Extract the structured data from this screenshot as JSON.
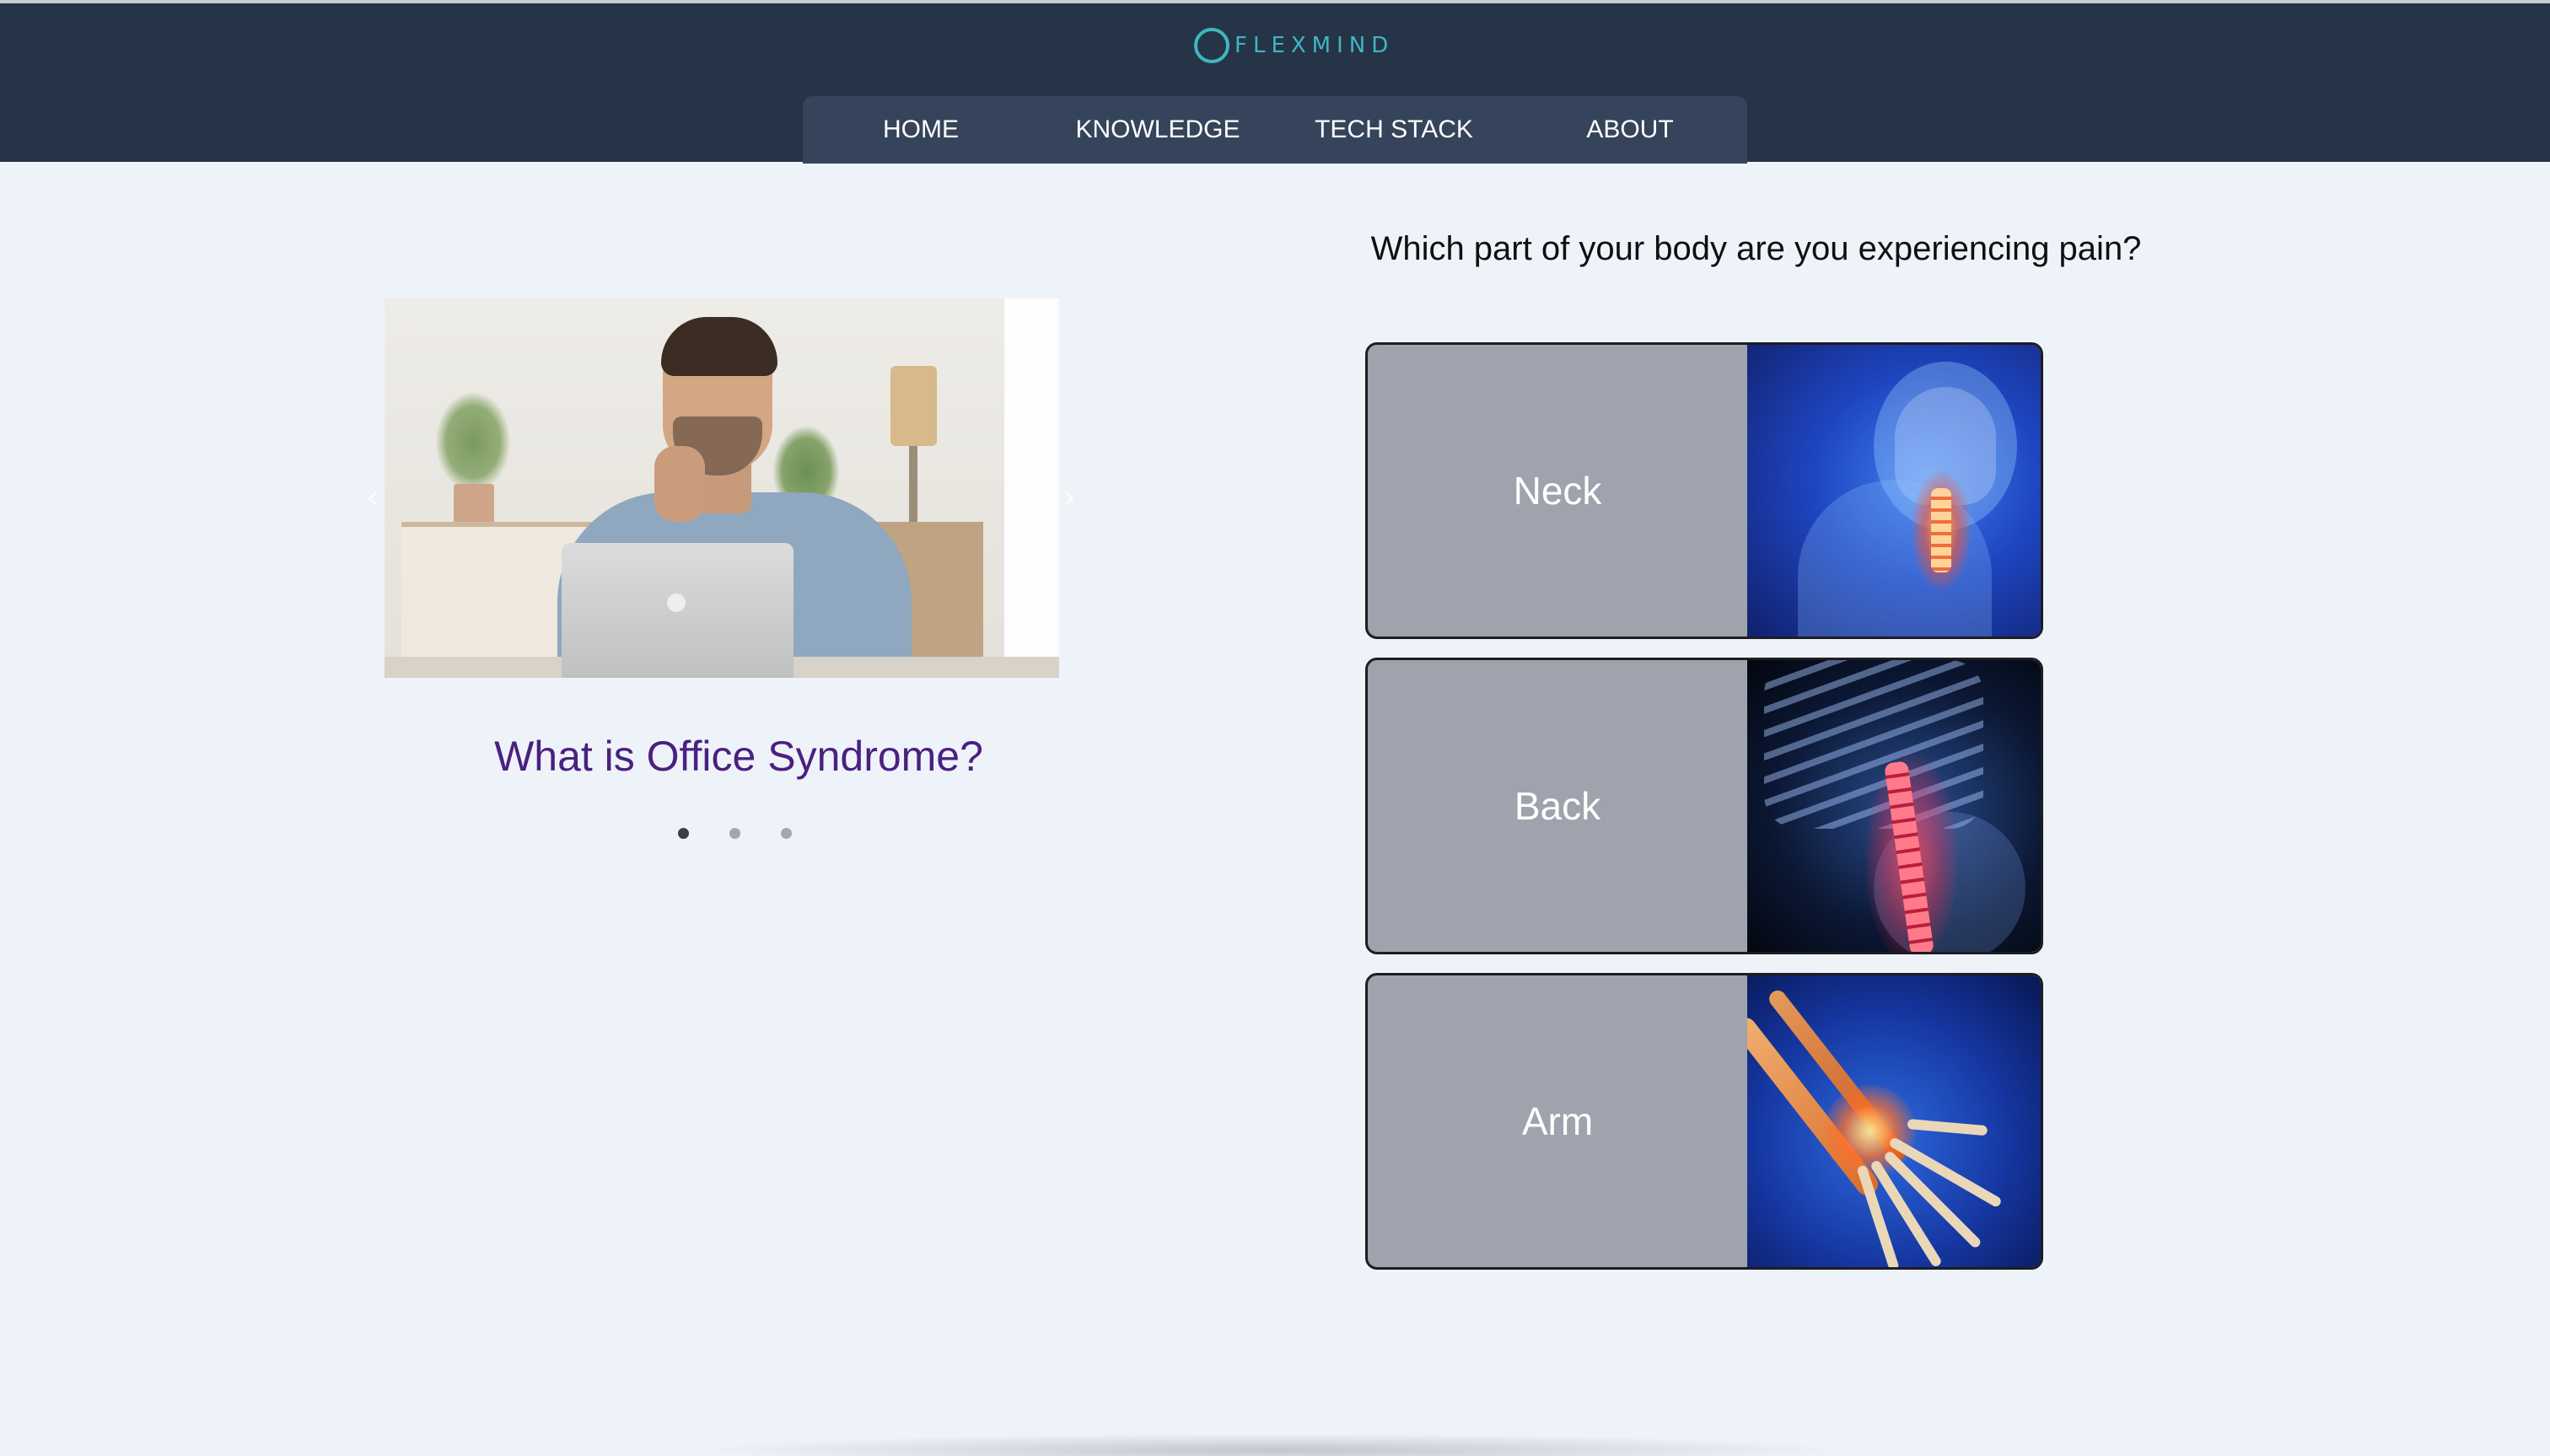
{
  "header": {
    "logo_text": "FLEXMIND",
    "logo_icon": "ring-logo-icon",
    "nav": [
      {
        "label": "HOME"
      },
      {
        "label": "KNOWLEDGE"
      },
      {
        "label": "TECH STACK"
      },
      {
        "label": "ABOUT"
      }
    ]
  },
  "carousel": {
    "caption": "What is Office Syndrome?",
    "prev_icon": "chevron-left-icon",
    "next_icon": "chevron-right-icon",
    "slide_count": 3,
    "active_index": 0
  },
  "pain_selector": {
    "question": "Which part of your body are you experiencing pain?",
    "options": [
      {
        "label": "Neck"
      },
      {
        "label": "Back"
      },
      {
        "label": "Arm"
      }
    ]
  },
  "colors": {
    "header_bg": "#263447",
    "nav_bg": "#35445a",
    "logo_accent": "#3fb6c1",
    "page_bg": "#eef3fa",
    "caption_color": "#4a2080",
    "card_label_bg": "#9fa3ad"
  }
}
